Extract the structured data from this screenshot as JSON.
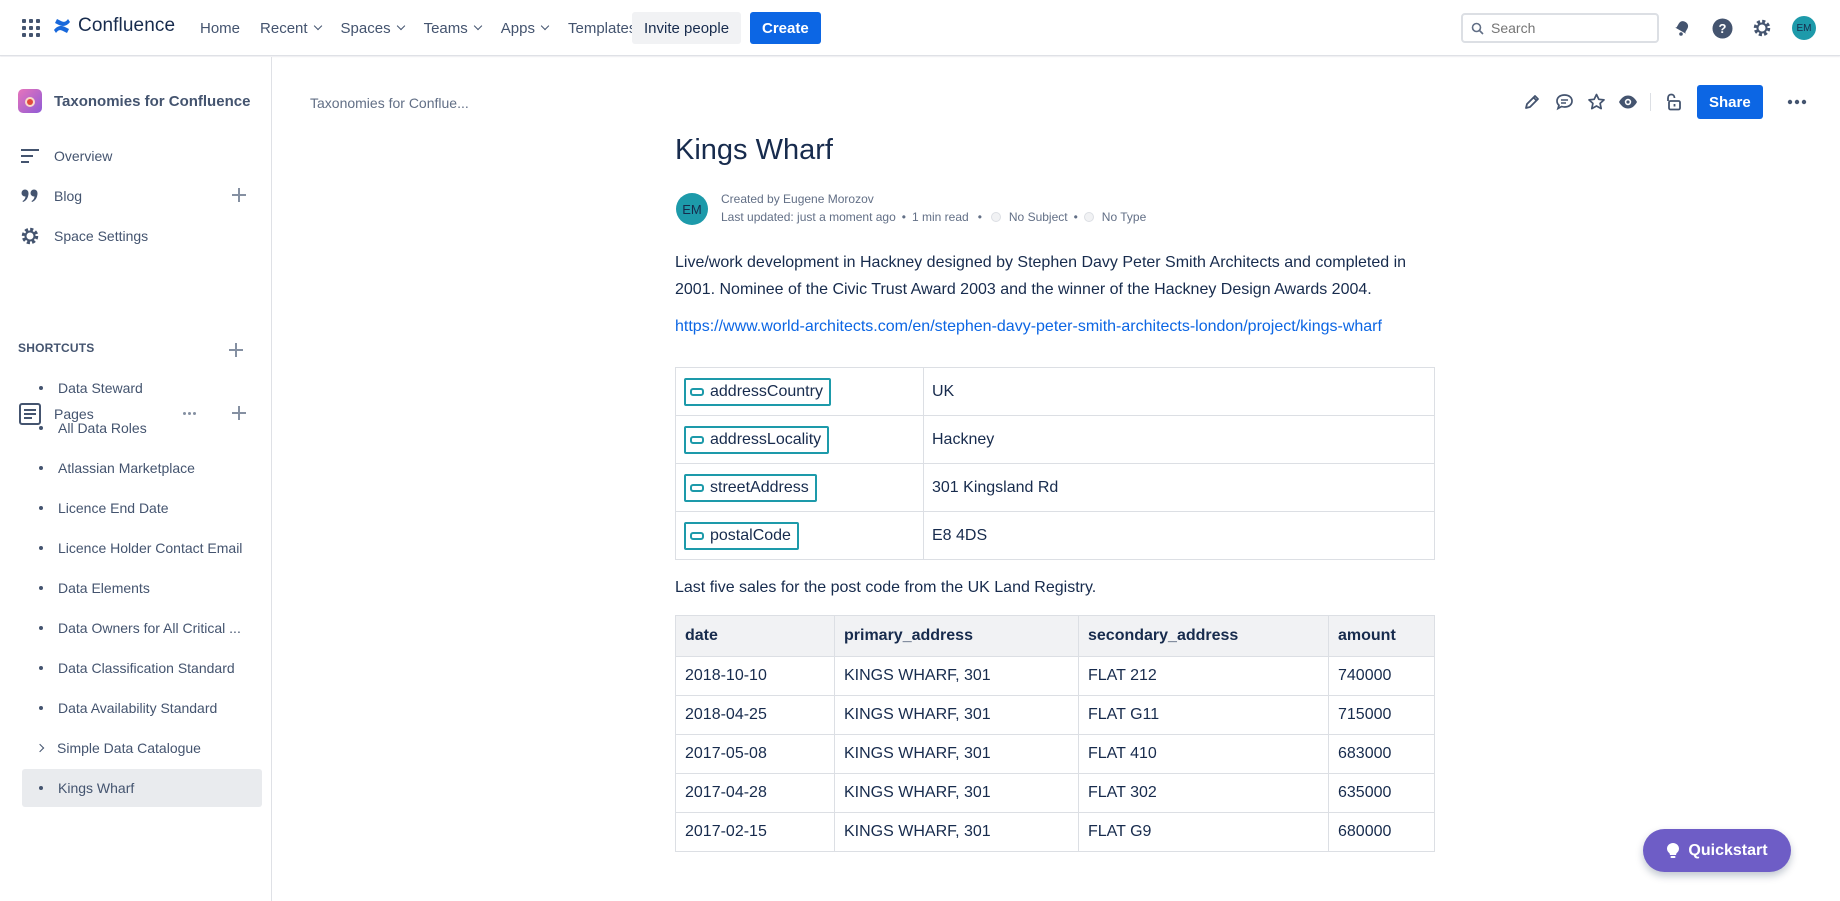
{
  "topnav": {
    "logo_text": "Confluence",
    "items": [
      {
        "label": "Home",
        "dropdown": false
      },
      {
        "label": "Recent",
        "dropdown": true
      },
      {
        "label": "Spaces",
        "dropdown": true
      },
      {
        "label": "Teams",
        "dropdown": true
      },
      {
        "label": "Apps",
        "dropdown": true
      },
      {
        "label": "Templates",
        "dropdown": false
      }
    ],
    "invite_label": "Invite people",
    "create_label": "Create",
    "search_placeholder": "Search",
    "avatar_initials": "EM",
    "colors": {
      "primary": "#0C66E4",
      "avatar": "#1D9AAA"
    }
  },
  "sidebar": {
    "space_name": "Taxonomies for Confluence",
    "nav": [
      {
        "label": "Overview",
        "icon": "overview-icon"
      },
      {
        "label": "Blog",
        "icon": "quote-icon"
      },
      {
        "label": "Space Settings",
        "icon": "gear-icon"
      }
    ],
    "shortcuts_label": "SHORTCUTS",
    "pages_label": "Pages",
    "pages": [
      {
        "label": "Data Steward"
      },
      {
        "label": "All Data Roles"
      },
      {
        "label": "Atlassian Marketplace"
      },
      {
        "label": "Licence End Date"
      },
      {
        "label": "Licence Holder Contact Email"
      },
      {
        "label": "Data Elements"
      },
      {
        "label": "Data Owners for All Critical ..."
      },
      {
        "label": "Data Classification Standard"
      },
      {
        "label": "Data Availability Standard"
      },
      {
        "label": "Simple Data Catalogue",
        "expandable": true
      },
      {
        "label": "Kings Wharf",
        "active": true
      }
    ]
  },
  "main": {
    "breadcrumb": "Taxonomies for Conflue...",
    "share_label": "Share",
    "title": "Kings Wharf",
    "byline": {
      "created_by": "Created by Eugene Morozov",
      "last_updated": "Last updated: just a moment ago",
      "read_time": "1 min read",
      "subject": "No Subject",
      "type": "No Type",
      "avatar_initials": "EM"
    },
    "description": "Live/work development in Hackney designed by Stephen Davy Peter Smith Architects and completed in 2001. Nominee of the Civic Trust Award 2003 and the winner of the Hackney Design Awards 2004.",
    "link": "https://www.world-architects.com/en/stephen-davy-peter-smith-architects-london/project/kings-wharf",
    "properties": [
      {
        "key": "addressCountry",
        "value": "UK"
      },
      {
        "key": "addressLocality",
        "value": "Hackney"
      },
      {
        "key": "streetAddress",
        "value": "301 Kingsland Rd"
      },
      {
        "key": "postalCode",
        "value": "E8 4DS"
      }
    ],
    "sales_caption": "Last five sales for the post code from the UK Land Registry.",
    "sales_headers": [
      "date",
      "primary_address",
      "secondary_address",
      "amount"
    ],
    "sales_rows": [
      [
        "2018-10-10",
        "KINGS WHARF, 301",
        "FLAT 212",
        "740000"
      ],
      [
        "2018-04-25",
        "KINGS WHARF, 301",
        "FLAT G11",
        "715000"
      ],
      [
        "2017-05-08",
        "KINGS WHARF, 301",
        "FLAT 410",
        "683000"
      ],
      [
        "2017-04-28",
        "KINGS WHARF, 301",
        "FLAT 302",
        "635000"
      ],
      [
        "2017-02-15",
        "KINGS WHARF, 301",
        "FLAT G9",
        "680000"
      ]
    ]
  },
  "quickstart_label": "Quickstart"
}
